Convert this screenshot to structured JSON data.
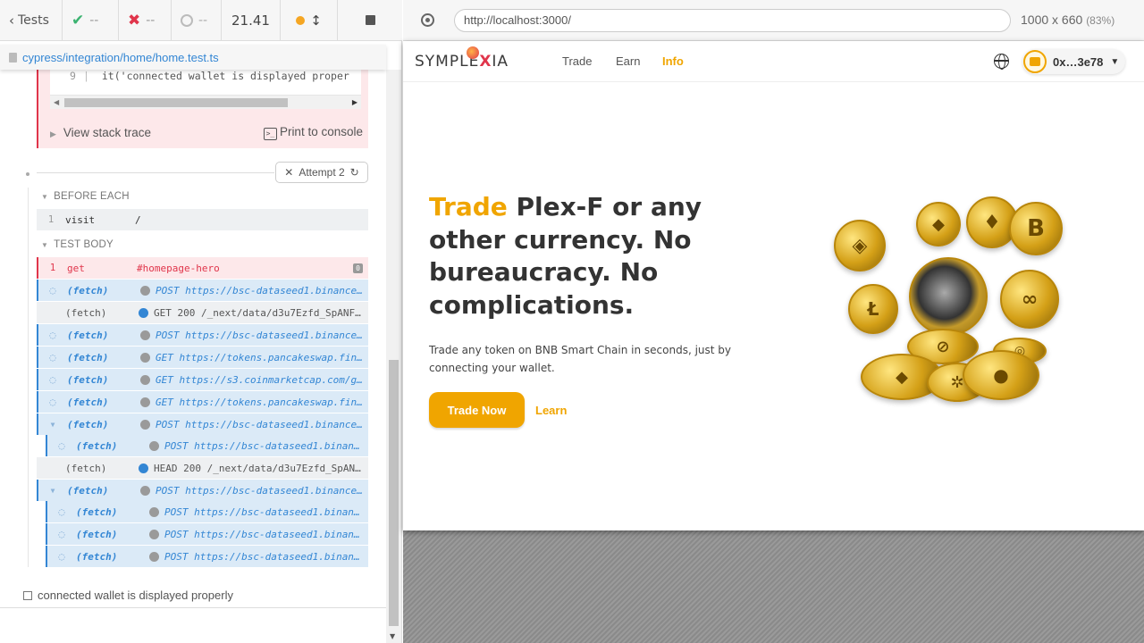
{
  "runner": {
    "topbar": {
      "tests_label": "Tests",
      "passed": "--",
      "failed": "--",
      "pending": "--",
      "duration": "21.41"
    },
    "spec_path": "cypress/integration/home/home.test.ts",
    "error": {
      "code_line_number": "9",
      "code_line_text": "it('connected wallet is displayed proper",
      "view_stack_trace": "View stack trace",
      "print_to_console": "Print to console"
    },
    "attempt_label": "Attempt 2",
    "before_each": {
      "label": "BEFORE EACH",
      "commands": [
        {
          "num": "1",
          "name": "visit",
          "message": "/"
        }
      ]
    },
    "test_body": {
      "label": "TEST BODY",
      "get_cmd": {
        "num": "1",
        "name": "get",
        "message": "#homepage-hero",
        "badge": "0"
      },
      "requests": [
        {
          "name": "(fetch)",
          "method": "POST",
          "url": "https://bsc-dataseed1.binance…"
        },
        {
          "name": "(fetch)",
          "method": "GET 200",
          "url": "/_next/data/d3u7Ezfd_SpANF…"
        },
        {
          "name": "(fetch)",
          "method": "POST",
          "url": "https://bsc-dataseed1.binance…"
        },
        {
          "name": "(fetch)",
          "method": "GET",
          "url": "https://tokens.pancakeswap.fin…"
        },
        {
          "name": "(fetch)",
          "method": "GET",
          "url": "https://s3.coinmarketcap.com/g…"
        },
        {
          "name": "(fetch)",
          "method": "GET",
          "url": "https://tokens.pancakeswap.fin…"
        },
        {
          "name": "(fetch)",
          "method": "POST",
          "url": "https://bsc-dataseed1.binance…"
        },
        {
          "name": "(fetch)",
          "method": "POST",
          "url": "https://bsc-dataseed1.binanc…"
        },
        {
          "name": "(fetch)",
          "method": "HEAD 200",
          "url": "/_next/data/d3u7Ezfd_SpAN…"
        },
        {
          "name": "(fetch)",
          "method": "POST",
          "url": "https://bsc-dataseed1.binance…"
        },
        {
          "name": "(fetch)",
          "method": "POST",
          "url": "https://bsc-dataseed1.binanc…"
        },
        {
          "name": "(fetch)",
          "method": "POST",
          "url": "https://bsc-dataseed1.binanc…"
        },
        {
          "name": "(fetch)",
          "method": "POST",
          "url": "https://bsc-dataseed1.binanc…"
        }
      ]
    },
    "test_title": "connected wallet is displayed properly"
  },
  "aut": {
    "url": "http://localhost:3000/",
    "viewport": "1000 x 660",
    "scale": "(83%)"
  },
  "site": {
    "logo": {
      "part1": "SYMPLE",
      "x": "X",
      "part2": "IA"
    },
    "nav": {
      "trade": "Trade",
      "earn": "Earn",
      "info": "Info"
    },
    "wallet_address": "0x…3e78",
    "hero": {
      "title_highlight": "Trade",
      "title_rest": " Plex-F or any other currency. No bureaucracy. No complications.",
      "subtitle": "Trade any token on BNB Smart Chain in seconds, just by connecting your wallet.",
      "trade_button": "Trade Now",
      "learn_link": "Learn"
    }
  },
  "colors": {
    "accent": "#f0a500",
    "fail": "#e0354b",
    "pass": "#3cb371",
    "link": "#3386d4"
  },
  "icons": [
    "chevron-left-icon",
    "check-icon",
    "x-icon",
    "pending-circle-icon",
    "running-dot-icon",
    "scroll-toggle-icon",
    "stop-icon",
    "file-icon",
    "terminal-icon",
    "attempt-icon",
    "refresh-icon",
    "spinner-icon",
    "target-icon",
    "globe-icon",
    "wallet-icon",
    "chevron-down-icon"
  ]
}
